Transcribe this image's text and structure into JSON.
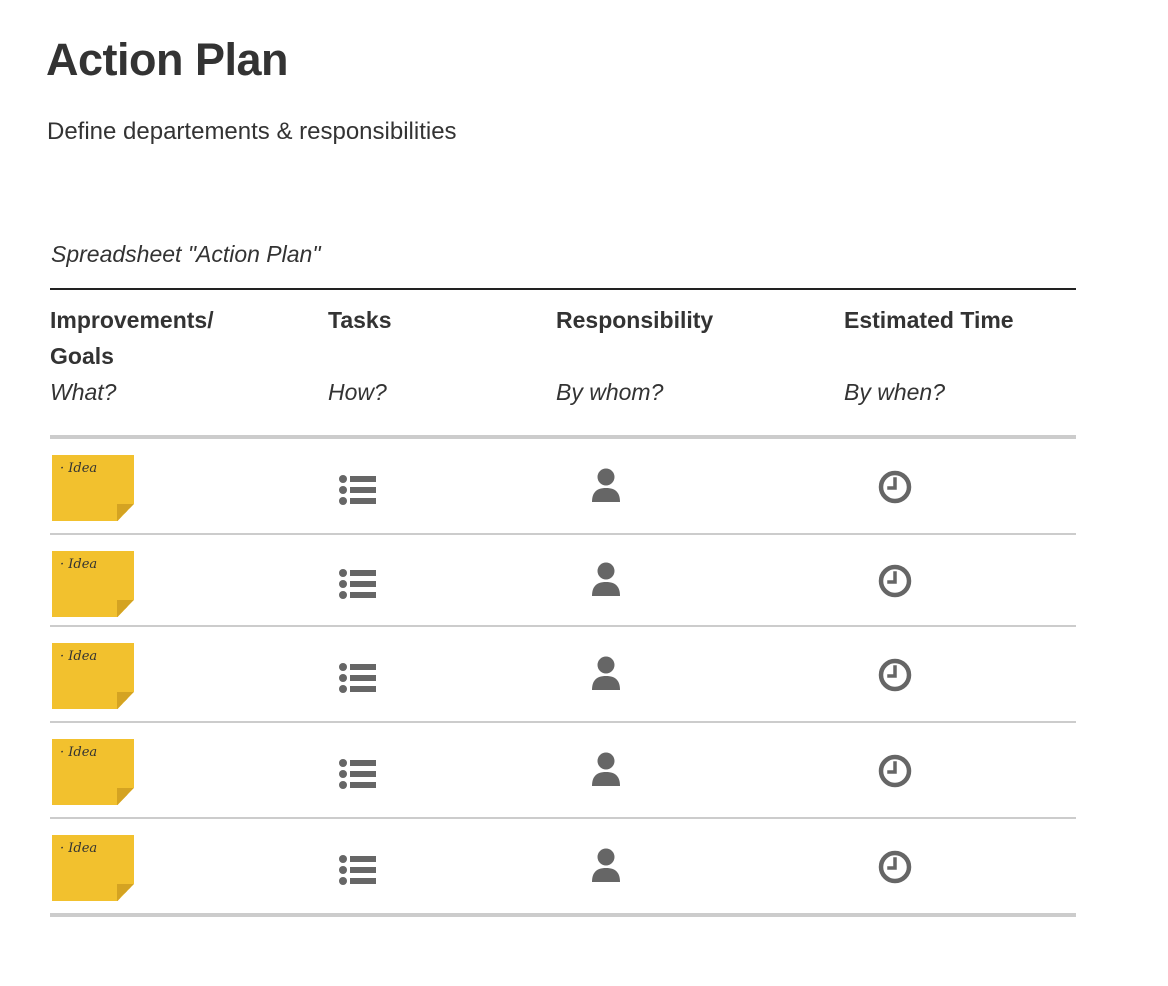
{
  "page": {
    "title": "Action Plan",
    "subtitle": "Define departements & responsibilities"
  },
  "spreadsheet": {
    "caption": "Spreadsheet \"Action Plan\"",
    "columns": [
      {
        "title": "Improvements/ Goals",
        "subtitle": "What?"
      },
      {
        "title": "Tasks",
        "subtitle": "How?"
      },
      {
        "title": "Responsibility",
        "subtitle": "By whom?"
      },
      {
        "title": "Estimated Time",
        "subtitle": "By when?"
      }
    ],
    "rows": [
      {
        "note": "· Idea",
        "task_icon": "list-icon",
        "responsibility_icon": "user-icon",
        "time_icon": "clock-icon"
      },
      {
        "note": "· Idea",
        "task_icon": "list-icon",
        "responsibility_icon": "user-icon",
        "time_icon": "clock-icon"
      },
      {
        "note": "· Idea",
        "task_icon": "list-icon",
        "responsibility_icon": "user-icon",
        "time_icon": "clock-icon"
      },
      {
        "note": "· Idea",
        "task_icon": "list-icon",
        "responsibility_icon": "user-icon",
        "time_icon": "clock-icon"
      },
      {
        "note": "· Idea",
        "task_icon": "list-icon",
        "responsibility_icon": "user-icon",
        "time_icon": "clock-icon"
      }
    ]
  },
  "colors": {
    "sticky_note": "#f2c12e",
    "icon": "#666666",
    "rule": "#cccccc"
  }
}
